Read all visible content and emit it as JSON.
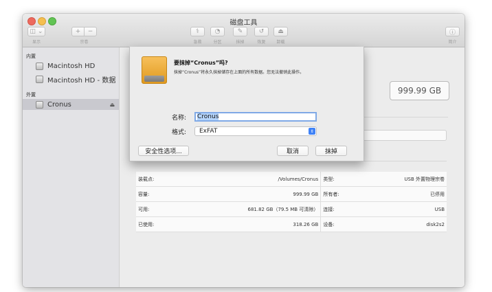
{
  "window": {
    "title": "磁盘工具"
  },
  "toolbar": {
    "view_label": "显示",
    "volume_label": "宗卷",
    "first_aid_label": "急救",
    "partition_label": "分区",
    "erase_label": "抹掉",
    "restore_label": "恢复",
    "unmount_label": "卸载",
    "info_label": "简介",
    "plus": "+",
    "minus": "−"
  },
  "sidebar": {
    "internal_header": "内置",
    "external_header": "外置",
    "items": [
      {
        "label": "Macintosh HD"
      },
      {
        "label": "Macintosh HD - 数据"
      },
      {
        "label": "Cronus",
        "eject": "⏏"
      }
    ]
  },
  "main": {
    "capacity": "999.99 GB",
    "info": [
      {
        "k1": "装载点:",
        "v1": "/Volumes/Cronus",
        "k2": "类型:",
        "v2": "USB 外置物理宗卷"
      },
      {
        "k1": "容量:",
        "v1": "999.99 GB",
        "k2": "所有者:",
        "v2": "已停用"
      },
      {
        "k1": "可用:",
        "v1": "681.82 GB（79.5 MB 可清除）",
        "k2": "连接:",
        "v2": "USB"
      },
      {
        "k1": "已使用:",
        "v1": "318.26 GB",
        "k2": "设备:",
        "v2": "disk2s2"
      }
    ]
  },
  "dialog": {
    "title": "要抹掉“Cronus”吗?",
    "message": "抹掉“Cronus”将永久抹掉储存在上面的所有数据。您无法撤销此操作。",
    "name_label": "名称:",
    "name_value": "Cronus",
    "format_label": "格式:",
    "format_value": "ExFAT",
    "security_button": "安全性选项...",
    "cancel_button": "取消",
    "erase_button": "抹掉"
  }
}
